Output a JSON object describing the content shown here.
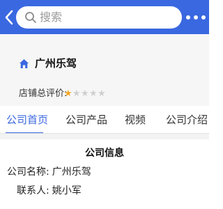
{
  "header": {
    "search_placeholder": "搜索",
    "accent": "#3a68e0"
  },
  "shop": {
    "name": "广州乐驾",
    "rating_label": "店铺总评价:",
    "rating_stars": 1,
    "rating_max": 5,
    "star_color": "#f3a51d"
  },
  "tabs": [
    {
      "label": "公司首页",
      "active": true
    },
    {
      "label": "公司产品",
      "active": false
    },
    {
      "label": "视频",
      "active": false
    },
    {
      "label": "公司介绍",
      "active": false
    }
  ],
  "company_info": {
    "title": "公司信息",
    "rows": [
      {
        "key": "公司名称:",
        "value": "广州乐驾"
      },
      {
        "key": "联系人:",
        "value": "姚小军"
      }
    ]
  }
}
